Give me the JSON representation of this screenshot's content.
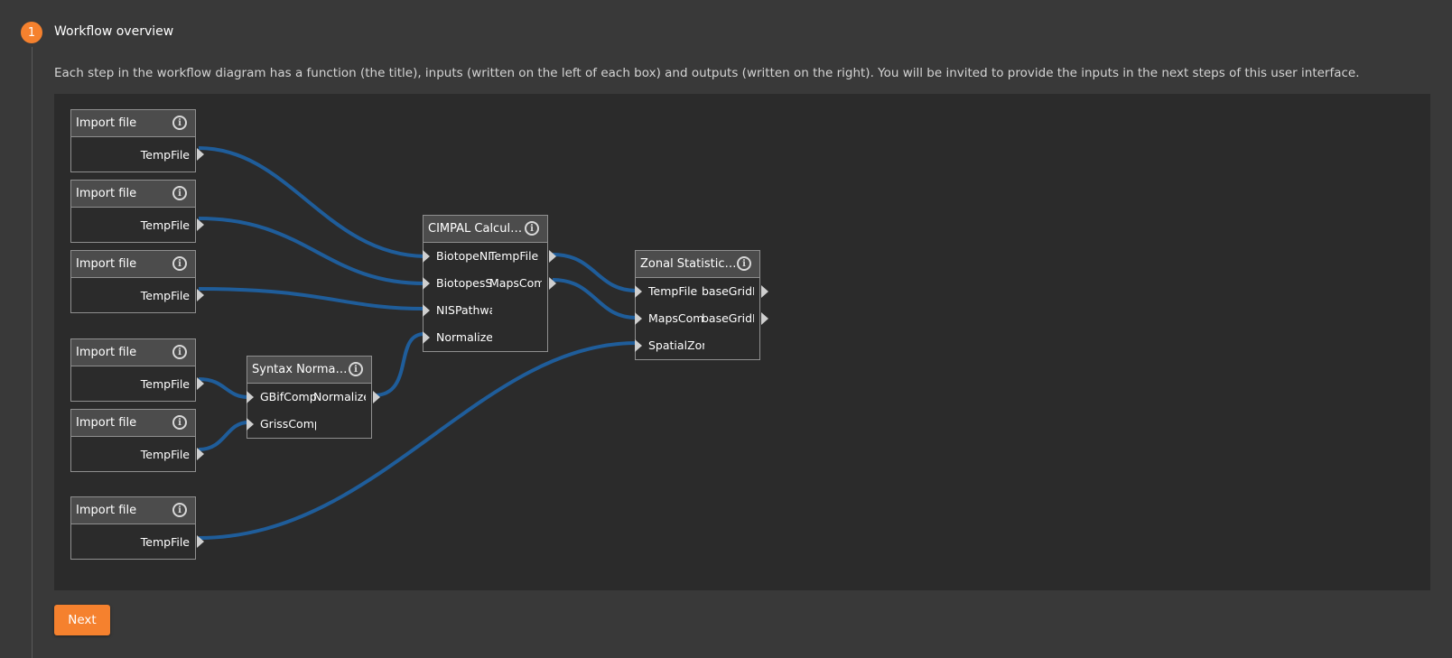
{
  "step": {
    "number": "1",
    "title": "Workflow overview"
  },
  "description": "Each step in the workflow diagram has a function (the title), inputs (written on the left of each box) and outputs (written on the right). You will be invited to provide the inputs in the next steps of this user interface.",
  "colors": {
    "accent": "#f5812e",
    "wire": "#1f5d9a",
    "node_header": "#4c4c4c",
    "canvas": "#2b2b2b",
    "page": "#393939"
  },
  "icons": {
    "info": "info-icon"
  },
  "info_glyph": "i",
  "nodes": {
    "import1": {
      "title": "Import file",
      "outputs": [
        "TempFile"
      ]
    },
    "import2": {
      "title": "Import file",
      "outputs": [
        "TempFile"
      ]
    },
    "import3": {
      "title": "Import file",
      "outputs": [
        "TempFile"
      ]
    },
    "import4": {
      "title": "Import file",
      "outputs": [
        "TempFile"
      ]
    },
    "import5": {
      "title": "Import file",
      "outputs": [
        "TempFile"
      ]
    },
    "import6": {
      "title": "Import file",
      "outputs": [
        "TempFile"
      ]
    },
    "syntax": {
      "title": "Syntax Normali...",
      "inputs": [
        "GBifComp",
        "GrissComp"
      ],
      "outputs": [
        "Normalized"
      ]
    },
    "cimpal": {
      "title": "CIMPAL Calcula...",
      "inputs": [
        "BiotopeNIS",
        "BiotopesSI",
        "NISPathway",
        "Normalized"
      ],
      "outputs": [
        "TempFile",
        "MapsComp"
      ]
    },
    "zonal": {
      "title": "Zonal Statistics...",
      "inputs": [
        "TempFile",
        "MapsComp",
        "SpatialZon"
      ],
      "outputs": [
        "baseGridLA",
        "baseGridLA"
      ]
    }
  },
  "next_label": "Next"
}
